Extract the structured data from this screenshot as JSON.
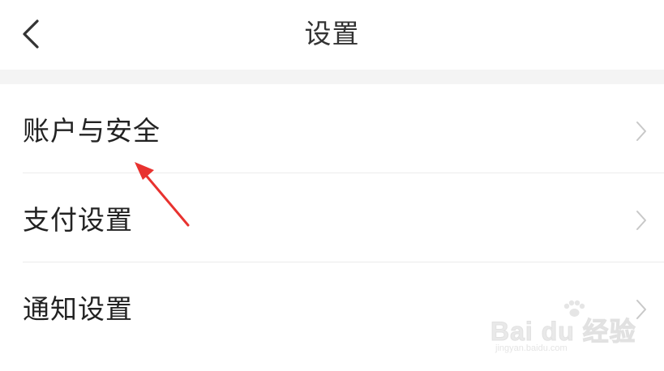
{
  "header": {
    "title": "设置",
    "back_icon": "chevron-left-icon"
  },
  "settings_list": [
    {
      "label": "账户与安全",
      "icon": "chevron-right-icon"
    },
    {
      "label": "支付设置",
      "icon": "chevron-right-icon"
    },
    {
      "label": "通知设置",
      "icon": "chevron-right-icon"
    }
  ],
  "annotation": {
    "arrow_color": "#e8322f",
    "points_to": "账户与安全"
  },
  "watermark": {
    "brand": "Bai du 经验",
    "url": "jingyan.baidu.com"
  },
  "colors": {
    "background": "#ffffff",
    "section_gap": "#f4f4f4",
    "divider": "#ececec",
    "chevron": "#c8c8c8",
    "text": "#222222"
  }
}
